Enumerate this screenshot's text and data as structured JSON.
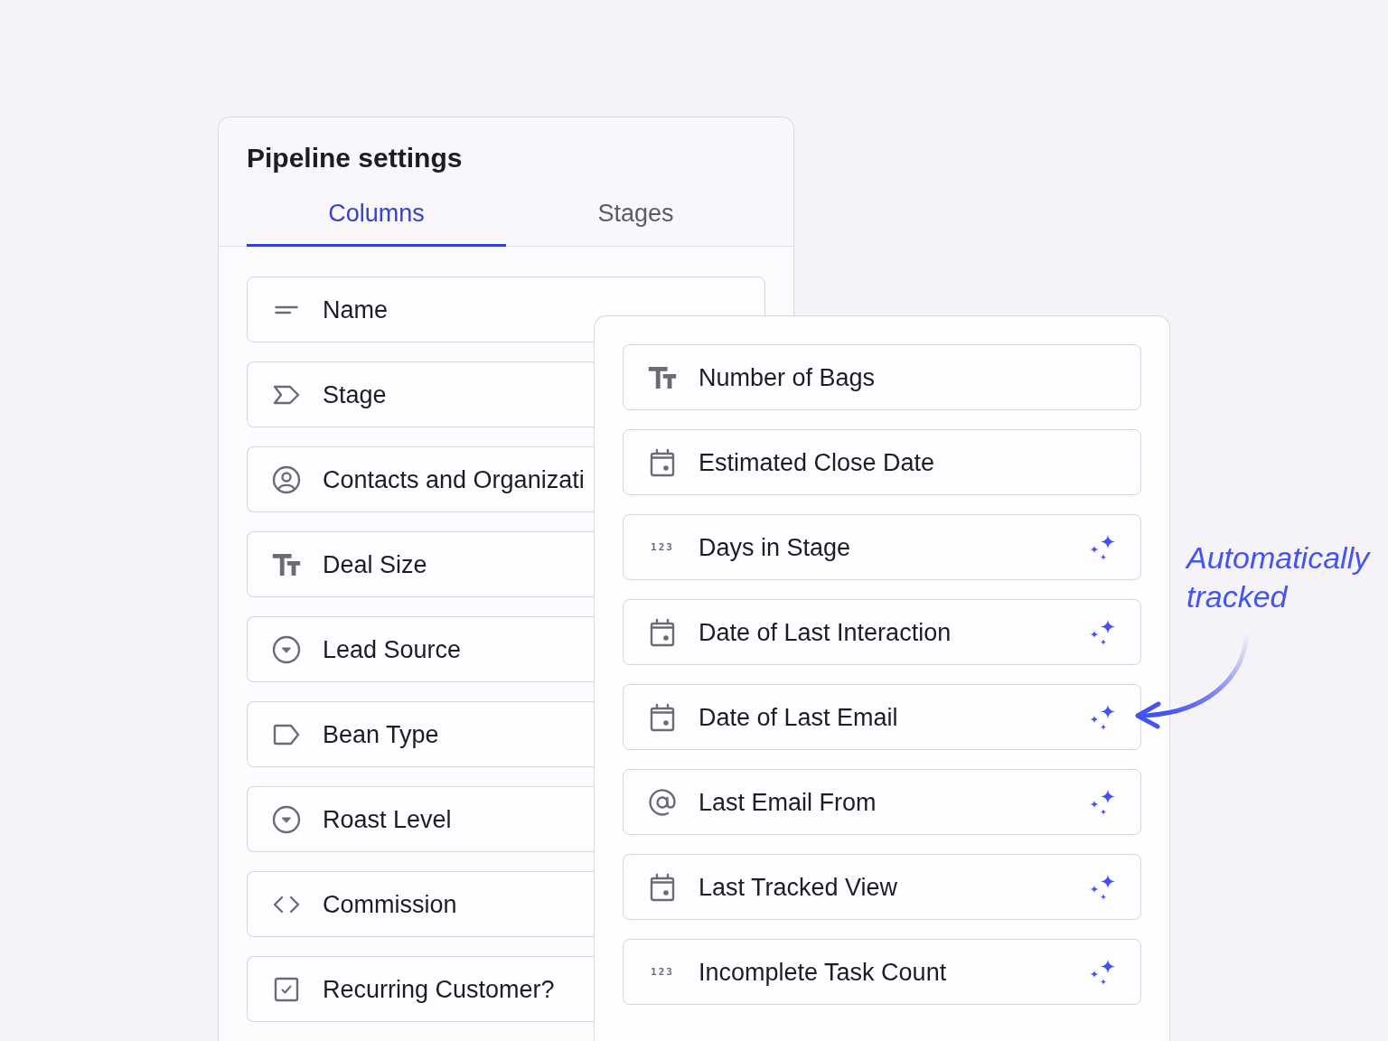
{
  "settings_panel": {
    "title": "Pipeline settings",
    "tabs": [
      {
        "label": "Columns",
        "selected": true
      },
      {
        "label": "Stages",
        "selected": false
      }
    ],
    "columns": [
      {
        "label": "Name",
        "kind": "lines"
      },
      {
        "label": "Stage",
        "kind": "stage"
      },
      {
        "label": "Contacts and Organizati",
        "kind": "contact"
      },
      {
        "label": "Deal Size",
        "kind": "text"
      },
      {
        "label": "Lead Source",
        "kind": "select"
      },
      {
        "label": "Bean Type",
        "kind": "tag"
      },
      {
        "label": "Roast Level",
        "kind": "select"
      },
      {
        "label": "Commission",
        "kind": "formula"
      },
      {
        "label": "Recurring Customer?",
        "kind": "checkbox"
      }
    ]
  },
  "tracked_panel": {
    "columns": [
      {
        "label": "Number of Bags",
        "kind": "text",
        "auto_tracked": false
      },
      {
        "label": "Estimated Close Date",
        "kind": "date",
        "auto_tracked": false
      },
      {
        "label": "Days in Stage",
        "kind": "number",
        "glyph": "123",
        "auto_tracked": true
      },
      {
        "label": "Date of Last Interaction",
        "kind": "date",
        "auto_tracked": true
      },
      {
        "label": "Date of Last Email",
        "kind": "date",
        "auto_tracked": true
      },
      {
        "label": "Last Email From",
        "kind": "email",
        "auto_tracked": true
      },
      {
        "label": "Last Tracked View",
        "kind": "date",
        "auto_tracked": true
      },
      {
        "label": "Incomplete Task Count",
        "kind": "number",
        "glyph": "123",
        "auto_tracked": true
      }
    ]
  },
  "annotation": {
    "text": "Automatically tracked"
  }
}
